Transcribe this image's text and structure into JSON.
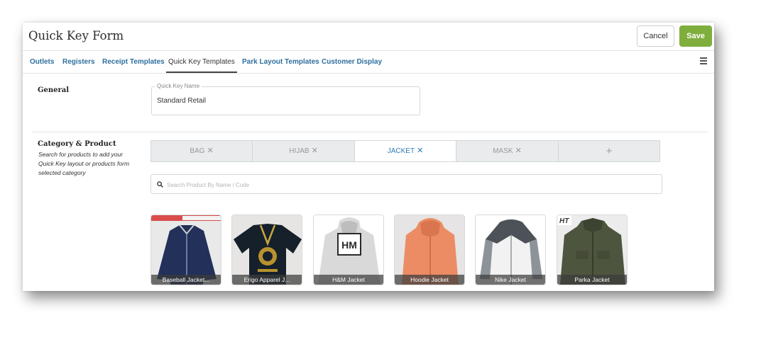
{
  "header": {
    "title": "Quick Key Form",
    "cancel_label": "Cancel",
    "save_label": "Save"
  },
  "tabs": [
    {
      "label": "Outlets"
    },
    {
      "label": "Registers"
    },
    {
      "label": "Receipt Templates"
    },
    {
      "label": "Quick Key Templates",
      "active": true
    },
    {
      "label": "Park Layout Templates"
    },
    {
      "label": "Customer Display"
    }
  ],
  "general": {
    "title": "General",
    "field_label": "Quick Key Name",
    "field_value": "Standard Retail"
  },
  "category": {
    "title": "Category & Product",
    "description": "Search for products to add your Quick Key layout or products form selected category",
    "tabs": [
      {
        "label": "BAG",
        "remove": "✕"
      },
      {
        "label": "HIJAB",
        "remove": "✕"
      },
      {
        "label": "JACKET",
        "remove": "✕",
        "active": true
      },
      {
        "label": "MASK",
        "remove": "✕"
      }
    ],
    "add_label": "+",
    "search_placeholder": "Search Product By Name / Code"
  },
  "products": [
    {
      "label": "Baseball Jacket...",
      "icon": "navy-bomber-jacket"
    },
    {
      "label": "Erigo Apparel J...",
      "icon": "black-kimono-jacket"
    },
    {
      "label": "H&M Jacket",
      "icon": "grey-hoodie-hm",
      "print": "HM"
    },
    {
      "label": "Hoodie Jacket",
      "icon": "orange-hoodie"
    },
    {
      "label": "Nike Jacket",
      "icon": "white-grey-windbreaker"
    },
    {
      "label": "Parka Jacket",
      "icon": "olive-parka",
      "badge": "HT"
    }
  ],
  "colors": {
    "accent": "#2e6f9e",
    "save": "#7fae3d",
    "active_category": "#2e7db5"
  }
}
